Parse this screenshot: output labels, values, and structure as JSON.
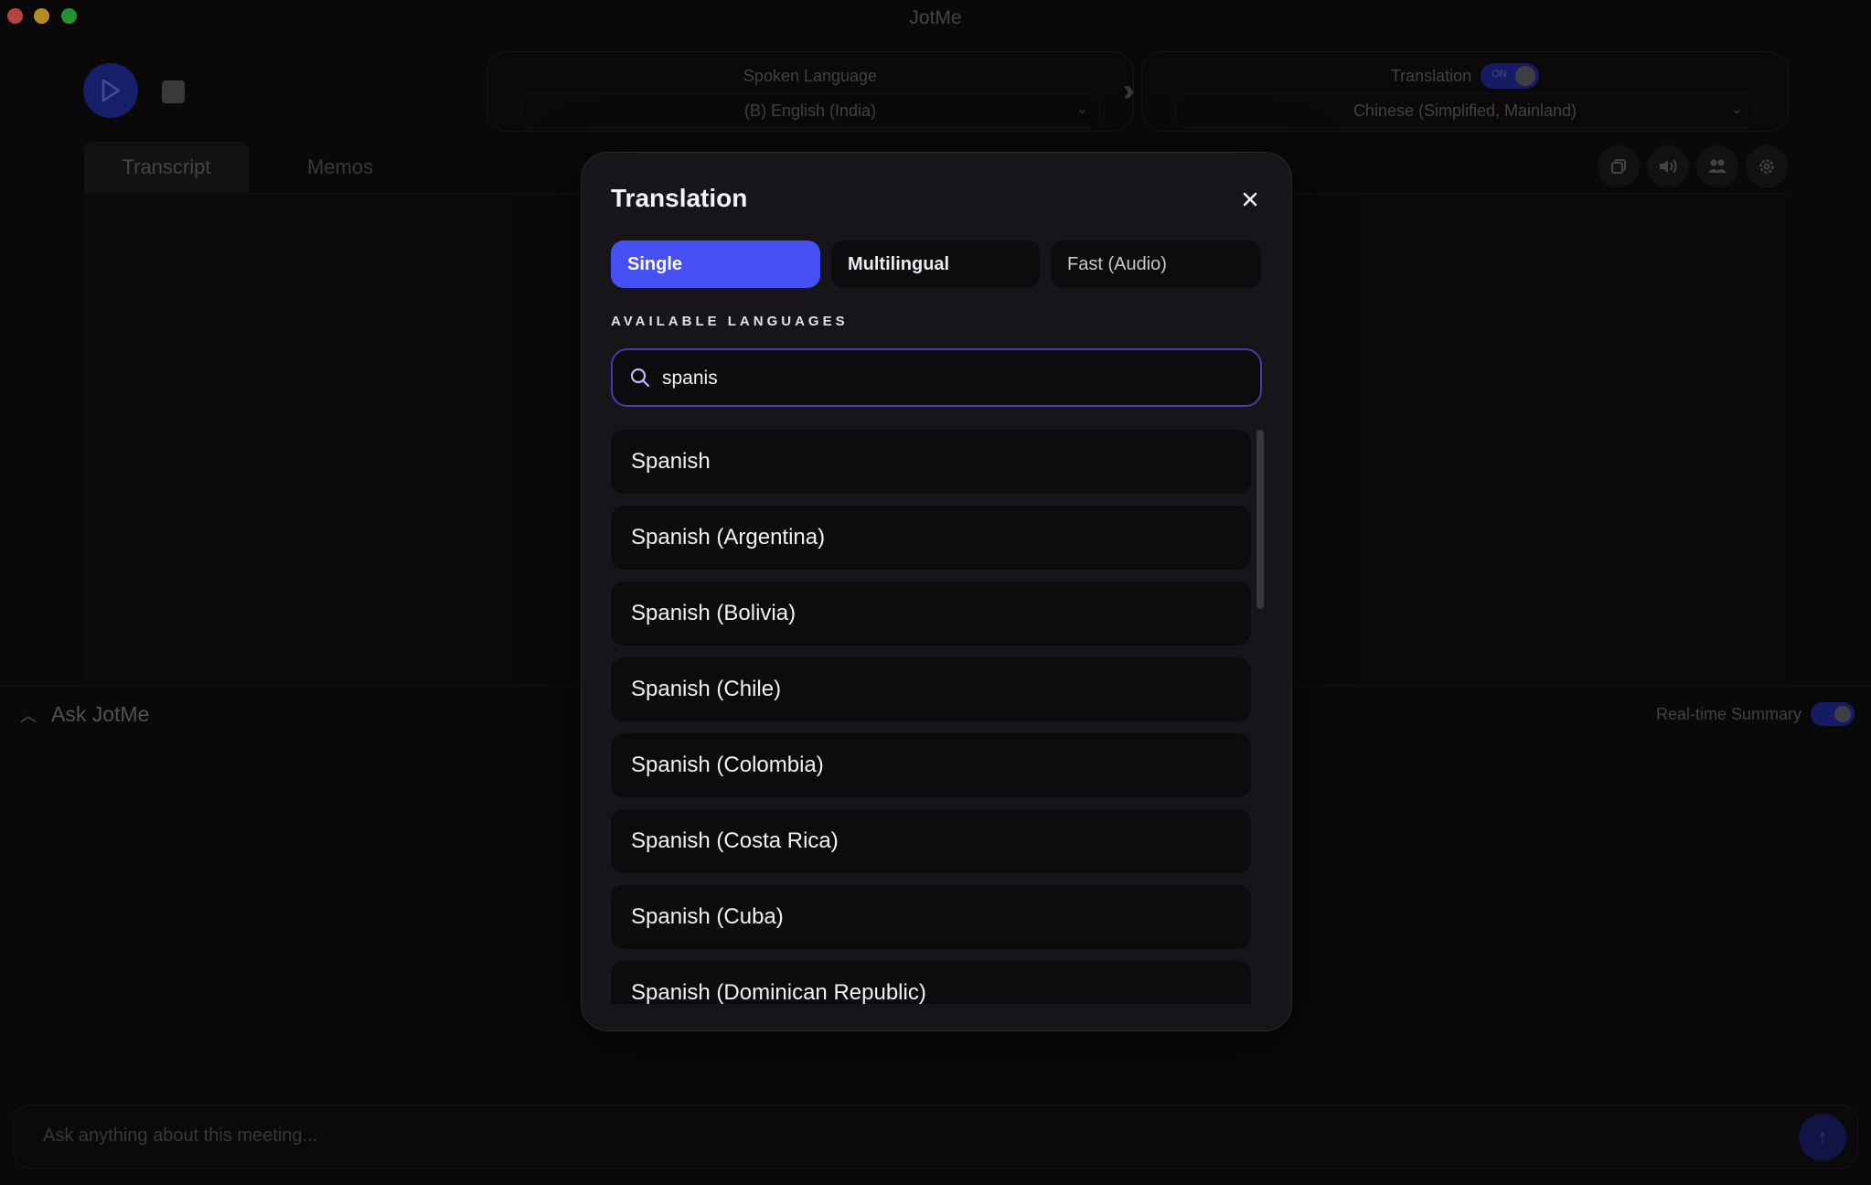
{
  "window": {
    "title": "JotMe"
  },
  "controls": {
    "spoken_language_label": "Spoken Language",
    "spoken_language_value": "(B) English (India)",
    "translation_label": "Translation",
    "translation_toggle": "ON",
    "translation_language_value": "Chinese (Simplified, Mainland)"
  },
  "tabs": [
    {
      "label": "Transcript",
      "active": true
    },
    {
      "label": "Memos",
      "active": false
    }
  ],
  "toolbar_icons": [
    "copy-icon",
    "speaker-icon",
    "people-icon",
    "gear-icon"
  ],
  "ask": {
    "title": "Ask JotMe",
    "realtime_summary_label": "Real-time Summary",
    "realtime_summary_on": true,
    "input_placeholder": "Ask anything about this meeting..."
  },
  "modal": {
    "title": "Translation",
    "modes": [
      {
        "label": "Single",
        "selected": true
      },
      {
        "label": "Multilingual",
        "selected": false
      },
      {
        "label": "Fast (Audio)",
        "selected": false
      }
    ],
    "section_label": "AVAILABLE LANGUAGES",
    "search_value": "spanis",
    "languages": [
      "Spanish",
      "Spanish (Argentina)",
      "Spanish (Bolivia)",
      "Spanish (Chile)",
      "Spanish (Colombia)",
      "Spanish (Costa Rica)",
      "Spanish (Cuba)",
      "Spanish (Dominican Republic)"
    ]
  },
  "colors": {
    "accent": "#4551f5",
    "background": "#0e0b0d",
    "modal_background": "#18151a",
    "search_border": "#3c43a8"
  }
}
